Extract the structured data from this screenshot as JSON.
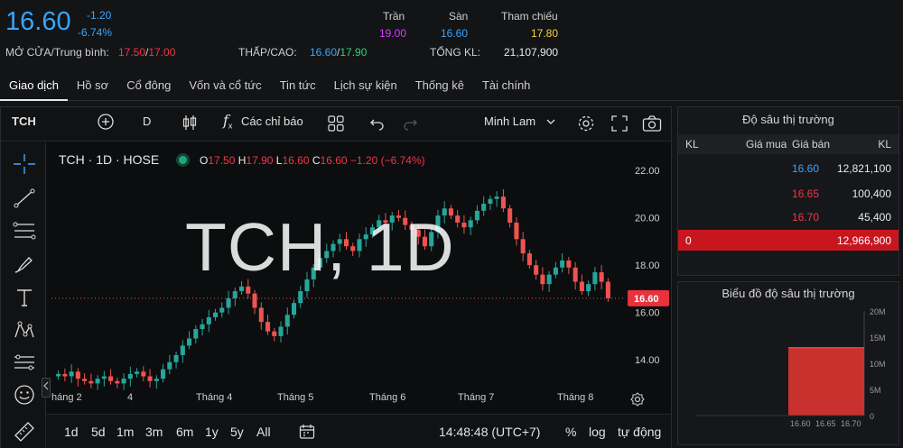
{
  "header": {
    "price": "16.60",
    "change": "-1.20",
    "change_pct": "-6.74%",
    "open_avg_label": "MỞ CỬA/Trung bình:",
    "open": "17.50",
    "avg": "17.00",
    "ceiling_label": "Trần",
    "ceiling": "19.00",
    "floor_label": "Sàn",
    "floor": "16.60",
    "ref_label": "Tham chiếu",
    "ref": "17.80",
    "lowhigh_label": "THẤP/CAO:",
    "low": "16.60",
    "high": "17.90",
    "volume_label": "TỔNG KL:",
    "volume": "21,107,900",
    "sep": "/"
  },
  "tabs": [
    "Giao dịch",
    "Hồ sơ",
    "Cổ đông",
    "Vốn và cổ tức",
    "Tin tức",
    "Lịch sự kiện",
    "Thống kê",
    "Tài chính"
  ],
  "toolbar": {
    "symbol": "TCH",
    "interval": "D",
    "indicators_label": "Các chỉ báo",
    "fx": "f",
    "fx_sub": "x",
    "theme": "Minh Lam"
  },
  "chart": {
    "legend_title": "TCH · 1D · HOSE",
    "o_label": "O",
    "o": "17.50",
    "h_label": "H",
    "h": "17.90",
    "l_label": "L",
    "l": "16.60",
    "c_label": "C",
    "c": "16.60",
    "chg": "−1.20 (−6.74%)",
    "watermark": "TCH, 1D",
    "last_price": "16.60"
  },
  "chart_data": {
    "type": "candlestick",
    "title": "TCH · 1D · HOSE",
    "x_tick_labels": [
      "háng 2",
      "4",
      "Tháng 4",
      "Tháng 5",
      "Tháng 6",
      "Tháng 7",
      "Tháng 8"
    ],
    "y_tick_labels": [
      "22.00",
      "20.00",
      "18.00",
      "16.00",
      "14.00"
    ],
    "ylim": [
      12.9,
      23.0
    ],
    "y_ticks": [
      22,
      20,
      18,
      16,
      14
    ],
    "closes": [
      13.4,
      13.3,
      13.5,
      13.2,
      13.1,
      13.0,
      13.2,
      13.3,
      13.1,
      13.0,
      13.2,
      13.4,
      13.5,
      13.3,
      13.1,
      13.2,
      13.6,
      13.9,
      14.2,
      14.6,
      14.9,
      15.3,
      15.5,
      15.8,
      16.0,
      16.2,
      16.6,
      16.9,
      17.1,
      16.8,
      16.2,
      15.6,
      15.2,
      15.0,
      15.4,
      15.9,
      16.4,
      16.9,
      17.4,
      17.9,
      18.3,
      18.6,
      18.9,
      19.1,
      18.8,
      18.6,
      19.1,
      19.3,
      19.6,
      19.9,
      19.8,
      20.1,
      20.0,
      19.7,
      19.5,
      19.2,
      18.8,
      19.4,
      20.1,
      20.4,
      20.1,
      19.8,
      19.6,
      19.9,
      20.3,
      20.6,
      20.8,
      20.9,
      20.4,
      19.8,
      19.1,
      18.5,
      18.0,
      17.6,
      17.2,
      17.6,
      17.9,
      18.2,
      17.9,
      17.3,
      16.9,
      17.2,
      17.7,
      17.3,
      16.6
    ],
    "candle_up_color": "#26a69a",
    "candle_down_color": "#ef5350",
    "grid": false
  },
  "bottombar": {
    "ranges": [
      "1d",
      "5d",
      "1m",
      "3m",
      "6m",
      "1y",
      "5y",
      "All"
    ],
    "time": "14:48:48 (UTC+7)",
    "pct": "%",
    "log": "log",
    "auto": "tự động"
  },
  "depth": {
    "title": "Độ sâu thị trường",
    "col_kl": "KL",
    "col_bid": "Giá mua",
    "col_ask": "Giá bán",
    "col_kl2": "KL",
    "rows": [
      {
        "ask": "16.60",
        "vol": "12,821,100"
      },
      {
        "ask": "16.65",
        "vol": "100,400"
      },
      {
        "ask": "16.70",
        "vol": "45,400"
      }
    ],
    "total_left": "0",
    "total_right": "12,966,900",
    "chart_title": "Biểu đồ độ sâu thị trường",
    "chart_y_ticks": [
      "20M",
      "15M",
      "10M",
      "5M",
      "0"
    ],
    "chart_x_ticks": [
      "16.60",
      "16.65",
      "16.70"
    ],
    "chart_values_millions": [
      12.97
    ]
  },
  "colors": {
    "accent_blue": "#36a6ff",
    "red": "#f23645",
    "green": "#26a69a",
    "purple": "#d13cff",
    "yellow": "#f5d442"
  }
}
